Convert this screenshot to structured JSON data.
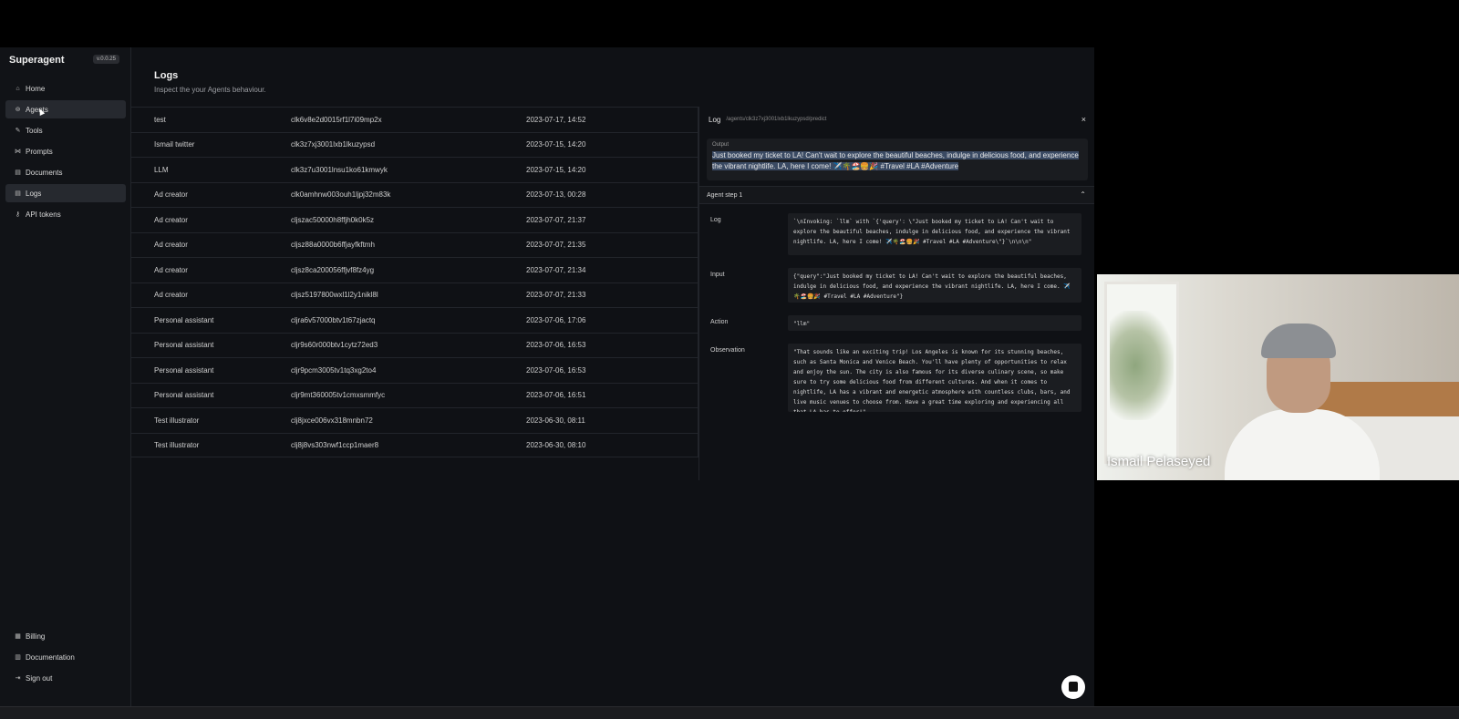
{
  "sidebar": {
    "brand": "Superagent",
    "version": "v.0.0.25",
    "items": [
      {
        "label": "Home",
        "icon": "home-icon",
        "glyph": "⌂"
      },
      {
        "label": "Agents",
        "icon": "agents-icon",
        "glyph": "⊚"
      },
      {
        "label": "Tools",
        "icon": "tools-icon",
        "glyph": "✎"
      },
      {
        "label": "Prompts",
        "icon": "prompts-icon",
        "glyph": "⋈"
      },
      {
        "label": "Documents",
        "icon": "documents-icon",
        "glyph": "▤"
      },
      {
        "label": "Logs",
        "icon": "logs-icon",
        "glyph": "▤"
      },
      {
        "label": "API tokens",
        "icon": "key-icon",
        "glyph": "⚷"
      }
    ],
    "bottom_items": [
      {
        "label": "Billing",
        "icon": "billing-icon",
        "glyph": "▦"
      },
      {
        "label": "Documentation",
        "icon": "documentation-icon",
        "glyph": "▥"
      },
      {
        "label": "Sign out",
        "icon": "sign-out-icon",
        "glyph": "⇥"
      }
    ]
  },
  "main": {
    "title": "Logs",
    "subtitle": "Inspect the your Agents behaviour.",
    "rows": [
      {
        "name": "test",
        "id": "clk6v8e2d0015rf1l7i09mp2x",
        "date": "2023-07-17, 14:52"
      },
      {
        "name": "Ismail twitter",
        "id": "clk3z7xj3001lxb1lkuzypsd",
        "date": "2023-07-15, 14:20"
      },
      {
        "name": "LLM",
        "id": "clk3z7u3001lnsu1ko61kmwyk",
        "date": "2023-07-15, 14:20"
      },
      {
        "name": "Ad creator",
        "id": "clk0amhnw003ouh1ljpj32m83k",
        "date": "2023-07-13, 00:28"
      },
      {
        "name": "Ad creator",
        "id": "cljszac50000h8ffjh0k0k5z",
        "date": "2023-07-07, 21:37"
      },
      {
        "name": "Ad creator",
        "id": "cljsz88a0000b6ffjayfkftmh",
        "date": "2023-07-07, 21:35"
      },
      {
        "name": "Ad creator",
        "id": "cljsz8ca200056ffjvf8fz4yg",
        "date": "2023-07-07, 21:34"
      },
      {
        "name": "Ad creator",
        "id": "cljsz5197800wxl1l2y1nikl8l",
        "date": "2023-07-07, 21:33"
      },
      {
        "name": "Personal assistant",
        "id": "cljra6v57000btv1t67zjactq",
        "date": "2023-07-06, 17:06"
      },
      {
        "name": "Personal assistant",
        "id": "cljr9s60r000btv1cytz72ed3",
        "date": "2023-07-06, 16:53"
      },
      {
        "name": "Personal assistant",
        "id": "cljr9pcm3005tv1tq3xg2to4",
        "date": "2023-07-06, 16:53"
      },
      {
        "name": "Personal assistant",
        "id": "cljr9mt360005tv1cmxsmmfyc",
        "date": "2023-07-06, 16:51"
      },
      {
        "name": "Test illustrator",
        "id": "clj8jxce006vx318mnbn72",
        "date": "2023-06-30, 08:11"
      },
      {
        "name": "Test illustrator",
        "id": "clj8j8vs303nwf1ccp1maer8",
        "date": "2023-06-30, 08:10"
      }
    ]
  },
  "detail": {
    "title": "Log",
    "path": "/agents/clk3z7xj3001lxb1lkuzypsd/predict",
    "close": "×",
    "output_label": "Output",
    "output_text": "Just booked my ticket to LA! Can't wait to explore the beautiful beaches, indulge in delicious food, and experience the vibrant nightlife. LA, here I come! ✈️🌴🏖️🍔🎉 #Travel #LA #Adventure",
    "step_title": "Agent step 1",
    "chevron": "⌃",
    "steps": [
      {
        "label": "Log",
        "text": "`\\nInvoking: `llm` with `{'query': \\\"Just booked my ticket to LA! Can't wait to explore the beautiful beaches, indulge in delicious food, and experience the vibrant nightlife. LA, here I come! ✈️🌴🏖️🍔🎉 #Travel #LA #Adventure\\\"}`\\n\\n\\n\""
      },
      {
        "label": "Input",
        "text": "{\"query\":\"Just booked my ticket to LA! Can't wait to explore the beautiful beaches, indulge in delicious food, and experience the vibrant nightlife. LA, here I come. ✈️🌴🏖️🍔🎉 #Travel #LA #Adventure\"}"
      },
      {
        "label": "Action",
        "text": "\"llm\""
      },
      {
        "label": "Observation",
        "text": "\"That sounds like an exciting trip! Los Angeles is known for its stunning beaches, such as Santa Monica and Venice Beach. You'll have plenty of opportunities to relax and enjoy the sun. The city is also famous for its diverse culinary scene, so make sure to try some delicious food from different cultures. And when it comes to nightlife, LA has a vibrant and energetic atmosphere with countless clubs, bars, and live music venues to choose from. Have a great time exploring and experiencing all that LA has to offer!\""
      }
    ]
  },
  "webcam": {
    "name": "Ismail Pelaseyed"
  }
}
